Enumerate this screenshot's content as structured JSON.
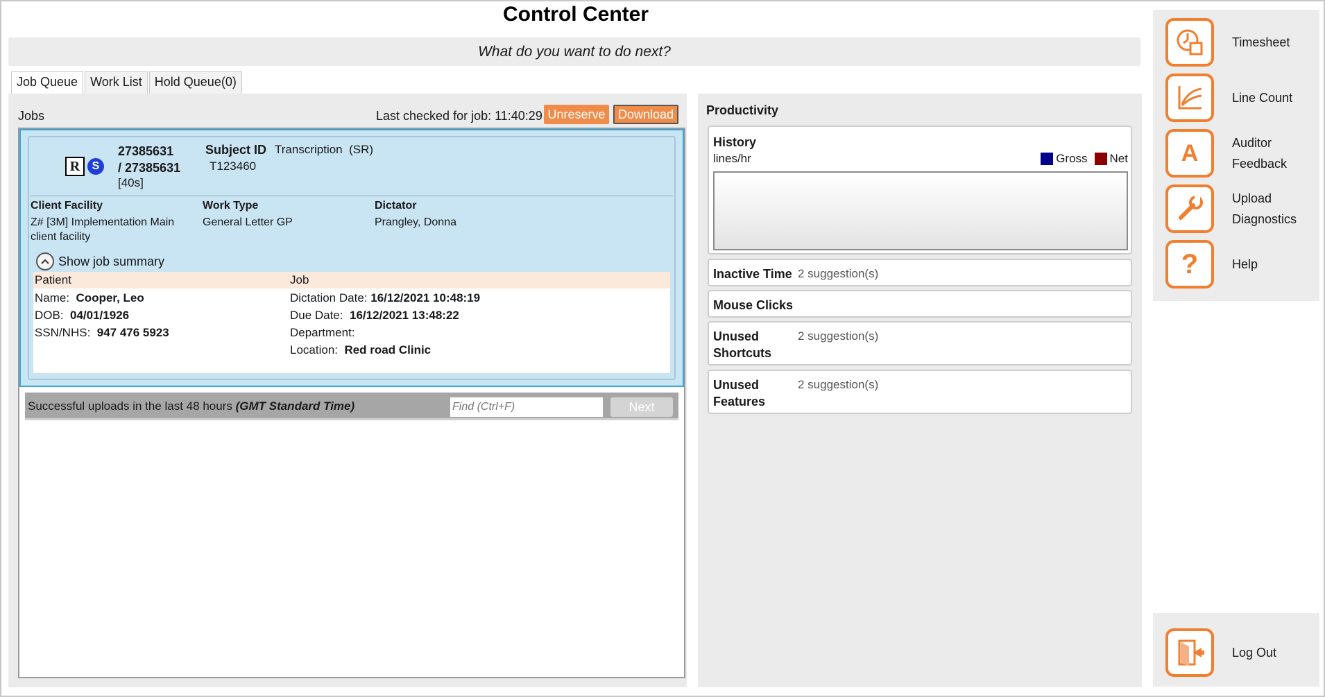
{
  "window": {
    "title": "Control Center",
    "prompt": "What do you want to do next?"
  },
  "tabs": [
    {
      "label": "Job Queue"
    },
    {
      "label": "Work List"
    },
    {
      "label": "Hold Queue(0)"
    }
  ],
  "jobs": {
    "label": "Jobs",
    "last_checked": "Last checked for job: 11:40:29",
    "unreserve_label": "Unreserve",
    "download_label": "Download",
    "card": {
      "badge_r": "R",
      "badge_s": "S",
      "job_id_line1": "27385631",
      "job_id_line2": "/ 27385631",
      "age": "[40s]",
      "subject_label": "Subject ID",
      "subject_value": "T123460",
      "transcription": "Transcription",
      "transcription_mode": "(SR)",
      "client_facility_label": "Client Facility",
      "client_facility_value": "Z# [3M] Implementation Main client facility",
      "work_type_label": "Work Type",
      "work_type_value": "General Letter GP",
      "dictator_label": "Dictator",
      "dictator_value": "Prangley, Donna",
      "show_summary": "Show job summary",
      "patient_header": "Patient",
      "job_header": "Job",
      "name_label": "Name:",
      "name_value": "Cooper, Leo",
      "dob_label": "DOB:",
      "dob_value": "04/01/1926",
      "ssn_label": "SSN/NHS:",
      "ssn_value": "947 476 5923",
      "dictation_date_label": "Dictation Date:",
      "dictation_date_value": "16/12/2021 10:48:19",
      "due_date_label": "Due Date:",
      "due_date_value": "16/12/2021 13:48:22",
      "department_label": "Department:",
      "department_value": "",
      "location_label": "Location:",
      "location_value": "Red road Clinic"
    },
    "uploads": {
      "text": "Successful uploads in the last 48 hours",
      "tz": "(GMT Standard Time)",
      "find_placeholder": "Find (Ctrl+F)",
      "next_label": "Next"
    }
  },
  "productivity": {
    "title": "Productivity",
    "history_title": "History",
    "history_units": "lines/hr",
    "legend": [
      {
        "label": "Gross",
        "color": "#00008b"
      },
      {
        "label": "Net",
        "color": "#8b0000"
      }
    ],
    "inactive_label": "Inactive Time",
    "inactive_sug": "2 suggestion(s)",
    "mouse_label": "Mouse Clicks",
    "shortcuts_label_1": "Unused",
    "shortcuts_label_2": "Shortcuts",
    "shortcuts_sug": "2 suggestion(s)",
    "features_label_1": "Unused",
    "features_label_2": "Features",
    "features_sug": "2 suggestion(s)"
  },
  "sidebar": {
    "accent": "#f07f2f",
    "items": [
      {
        "label": "Timesheet",
        "icon": "timesheet-icon"
      },
      {
        "label": "Line Count",
        "icon": "line-count-icon"
      },
      {
        "label_1": "Auditor",
        "label_2": "Feedback",
        "icon": "auditor-feedback-icon",
        "glyph": "A"
      },
      {
        "label_1": "Upload",
        "label_2": "Diagnostics",
        "icon": "wrench-icon"
      },
      {
        "label": "Help",
        "icon": "help-icon",
        "glyph": "?"
      }
    ],
    "logout": {
      "label": "Log Out",
      "icon": "logout-icon"
    }
  }
}
